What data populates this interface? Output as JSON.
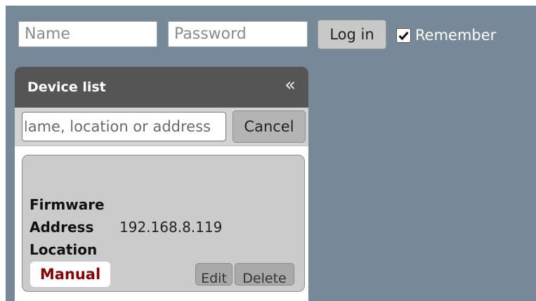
{
  "login": {
    "name_placeholder": "Name",
    "password_placeholder": "Password",
    "login_label": "Log in",
    "remember_label": "Remember",
    "remember_checked": true
  },
  "device_panel": {
    "title": "Device list",
    "collapse_glyph": "«",
    "search_placeholder": "Name, location or address",
    "cancel_label": "Cancel",
    "device": {
      "firmware_label": "Firmware",
      "firmware_value": "",
      "address_label": "Address",
      "address_value": "192.168.8.119",
      "location_label": "Location",
      "location_value": "",
      "mode_badge": "Manual",
      "edit_label": "Edit",
      "delete_label": "Delete"
    }
  },
  "colors": {
    "background": "#778899",
    "panel_header": "#555555",
    "card": "#cbcbcb",
    "badge_text": "#8b0000"
  }
}
